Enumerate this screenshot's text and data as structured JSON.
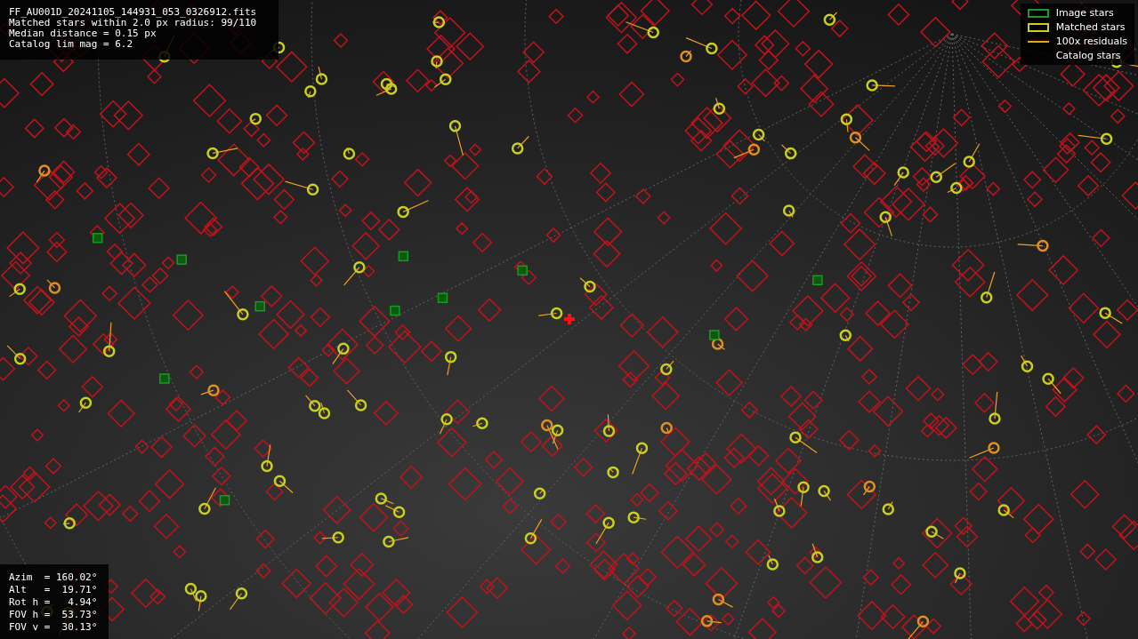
{
  "header_info": [
    "FF_AU001D_20241105_144931_053_0326912.fits",
    "Matched stars within 2.0 px radius: 99/110",
    "Median distance = 0.15 px",
    "Catalog lim mag = 6.2"
  ],
  "legend": [
    {
      "kind": "image",
      "label": "Image stars"
    },
    {
      "kind": "matched",
      "label": "Matched stars"
    },
    {
      "kind": "residual",
      "label": "100x residuals"
    },
    {
      "kind": "catalog",
      "label": "Catalog stars"
    }
  ],
  "pointing_info": [
    "Azim  = 160.02°",
    "Alt   =  19.71°",
    "Rot h =   4.94°",
    "FOV h =  53.73°",
    "FOV v =  30.13°"
  ]
}
